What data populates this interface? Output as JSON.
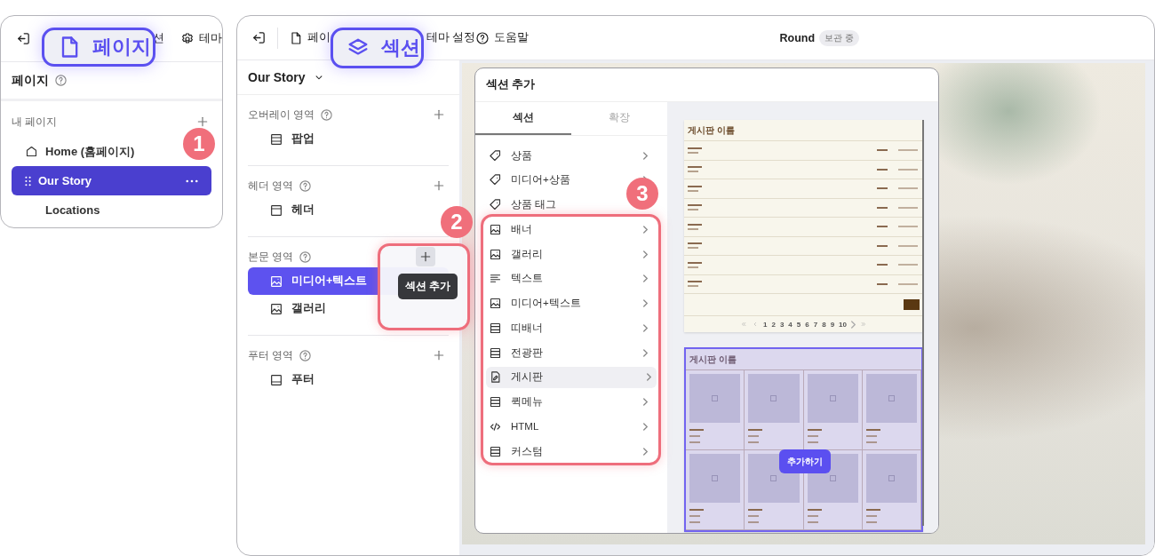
{
  "left_window": {
    "toolbar": [
      {
        "kind": "plain",
        "label": "션"
      },
      {
        "kind": "settings",
        "label": "테마"
      }
    ],
    "panel_title": "페이지",
    "section_label": "내 페이지",
    "pages": [
      {
        "kind": "home",
        "label": "Home (홈페이지)",
        "selected": false
      },
      {
        "kind": "page",
        "label": "Our Story",
        "selected": true
      },
      {
        "kind": "page",
        "label": "Locations",
        "selected": false
      }
    ]
  },
  "right_window": {
    "toolbar": [
      {
        "kind": "file",
        "label": "페이"
      },
      {
        "kind": "plain",
        "label": "테마 설정"
      },
      {
        "kind": "help",
        "label": "도움말"
      }
    ],
    "site_name": "Round",
    "status_badge": "보관 중",
    "sidebar": {
      "page_selector": "Our Story",
      "tooltip": "섹션 추가",
      "groups": [
        {
          "label": "오버레이 영역",
          "add_hovered": false,
          "items": [
            {
              "kind": "popup",
              "label": "팝업",
              "selected": false
            }
          ]
        },
        {
          "label": "헤더 영역",
          "add_hovered": false,
          "items": [
            {
              "kind": "header",
              "label": "헤더",
              "selected": false
            }
          ]
        },
        {
          "label": "본문 영역",
          "add_hovered": true,
          "items": [
            {
              "kind": "image",
              "label": "미디어+텍스트",
              "selected": true
            },
            {
              "kind": "image",
              "label": "갤러리",
              "selected": false
            }
          ]
        },
        {
          "label": "푸터 영역",
          "add_hovered": false,
          "items": [
            {
              "kind": "footer",
              "label": "푸터",
              "selected": false
            }
          ]
        }
      ]
    },
    "modal": {
      "title": "섹션 추가",
      "tabs": [
        {
          "label": "섹션",
          "selected": true
        },
        {
          "label": "확장",
          "selected": false
        }
      ],
      "items": [
        {
          "kind": "tag",
          "label": "상품",
          "selected": false
        },
        {
          "kind": "tag",
          "label": "미디어+상품",
          "selected": false
        },
        {
          "kind": "tag",
          "label": "상품 태그",
          "selected": false
        },
        {
          "kind": "image",
          "label": "배너",
          "selected": false
        },
        {
          "kind": "image",
          "label": "갤러리",
          "selected": false
        },
        {
          "kind": "text",
          "label": "텍스트",
          "selected": false
        },
        {
          "kind": "image",
          "label": "미디어+텍스트",
          "selected": false
        },
        {
          "kind": "popup",
          "label": "띠배너",
          "selected": false
        },
        {
          "kind": "popup",
          "label": "전광판",
          "selected": false
        },
        {
          "kind": "board",
          "label": "게시판",
          "selected": true
        },
        {
          "kind": "popup",
          "label": "퀵메뉴",
          "selected": false
        },
        {
          "kind": "code",
          "label": "HTML",
          "selected": false
        },
        {
          "kind": "popup",
          "label": "커스텀",
          "selected": false
        }
      ],
      "previews": [
        {
          "kind": "list",
          "title": "게시판 이름",
          "selected": false,
          "pages": [
            "1",
            "2",
            "3",
            "4",
            "5",
            "6",
            "7",
            "8",
            "9",
            "10"
          ]
        },
        {
          "kind": "gallery",
          "title": "게시판 이름",
          "selected": true,
          "button": "추가하기"
        }
      ]
    }
  },
  "overlay_badges": [
    {
      "kind": "file",
      "label": "페이지"
    },
    {
      "kind": "layers",
      "label": "섹션"
    }
  ],
  "callouts": [
    "1",
    "2",
    "3"
  ]
}
